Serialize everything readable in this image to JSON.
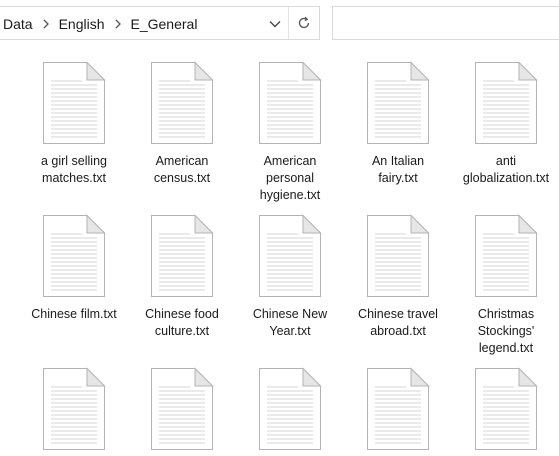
{
  "breadcrumb": {
    "parts": [
      "Data",
      "English",
      "E_General"
    ]
  },
  "icons": {
    "separator": "chevron-right-icon",
    "dropdown": "chevron-down-icon",
    "refresh": "refresh-icon",
    "file": "text-file-icon"
  },
  "files": [
    {
      "name": "a girl selling matches.txt",
      "lines": [
        "a girl selling",
        "matches.txt"
      ]
    },
    {
      "name": "American census.txt",
      "lines": [
        "American",
        "census.txt"
      ]
    },
    {
      "name": "American personal hygiene.txt",
      "lines": [
        "American",
        "personal",
        "hygiene.txt"
      ]
    },
    {
      "name": "An Italian fairy.txt",
      "lines": [
        "An Italian",
        "fairy.txt"
      ]
    },
    {
      "name": "anti globalization.txt",
      "lines": [
        "anti",
        "globalization.txt"
      ]
    },
    {
      "name": "Chinese film.txt",
      "lines": [
        "Chinese film.txt"
      ]
    },
    {
      "name": "Chinese food culture.txt",
      "lines": [
        "Chinese food",
        "culture.txt"
      ]
    },
    {
      "name": "Chinese New Year.txt",
      "lines": [
        "Chinese New",
        "Year.txt"
      ]
    },
    {
      "name": "Chinese travel abroad.txt",
      "lines": [
        "Chinese travel",
        "abroad.txt"
      ]
    },
    {
      "name": "Christmas Stockings' legend.txt",
      "lines": [
        "Christmas",
        "Stockings'",
        "legend.txt"
      ]
    },
    {
      "name": "",
      "lines": []
    },
    {
      "name": "",
      "lines": []
    },
    {
      "name": "",
      "lines": []
    },
    {
      "name": "",
      "lines": []
    },
    {
      "name": "",
      "lines": []
    }
  ],
  "colors": {
    "paper": "#ffffff",
    "border": "#b4b4b4",
    "fold": "#e6e6e6",
    "lines": "#d6d6d6"
  }
}
